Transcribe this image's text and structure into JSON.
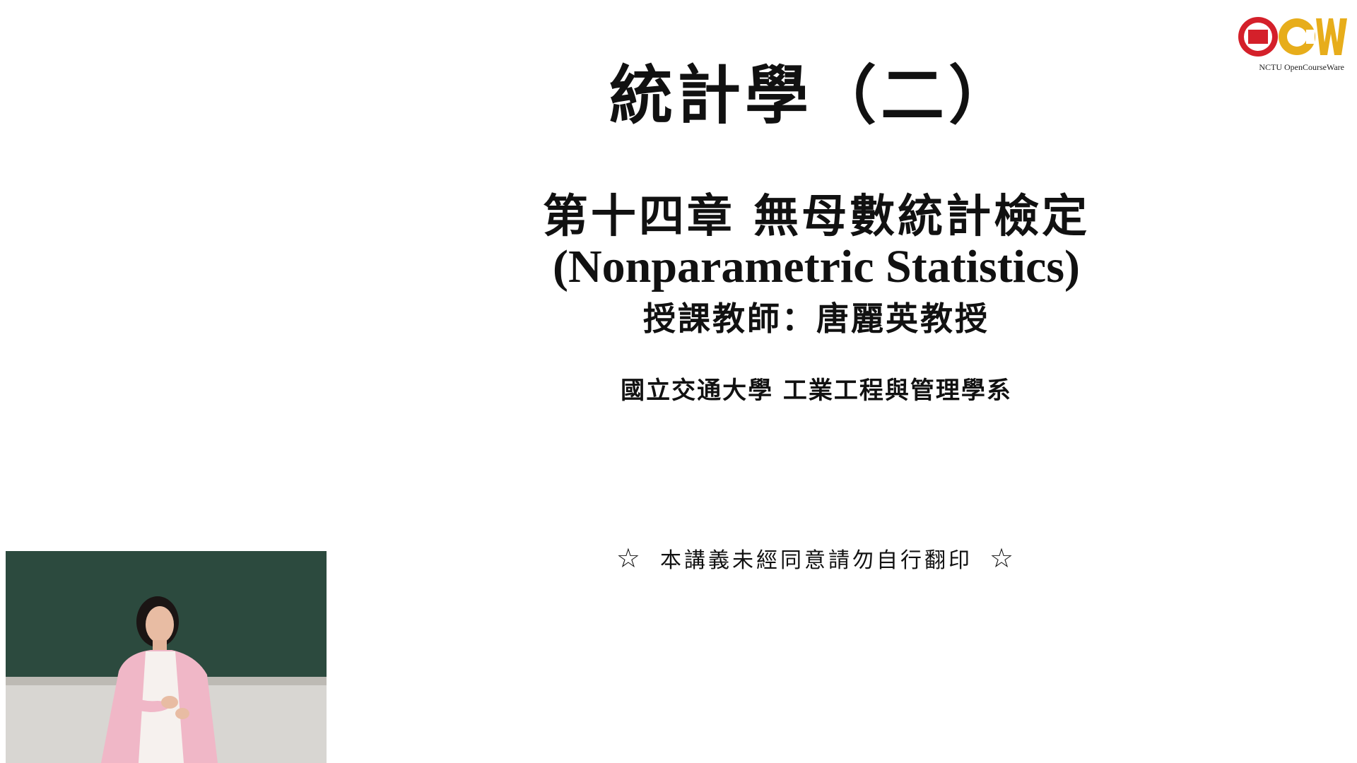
{
  "slide": {
    "title": "統計學（二）",
    "chapter": "第十四章  無母數統計檢定",
    "subtitle_en": "(Nonparametric Statistics)",
    "instructor": "授課教師：唐麗英教授",
    "department": "國立交通大學 工業工程與管理學系",
    "notice_star": "☆",
    "notice": "本講義未經同意請勿自行翻印"
  },
  "logo": {
    "letters": "OCW",
    "caption": "NCTU OpenCourseWare",
    "color_red": "#d4202a",
    "color_gold": "#e7ad1b"
  },
  "video": {
    "icon": "lecturer-video-feed"
  }
}
